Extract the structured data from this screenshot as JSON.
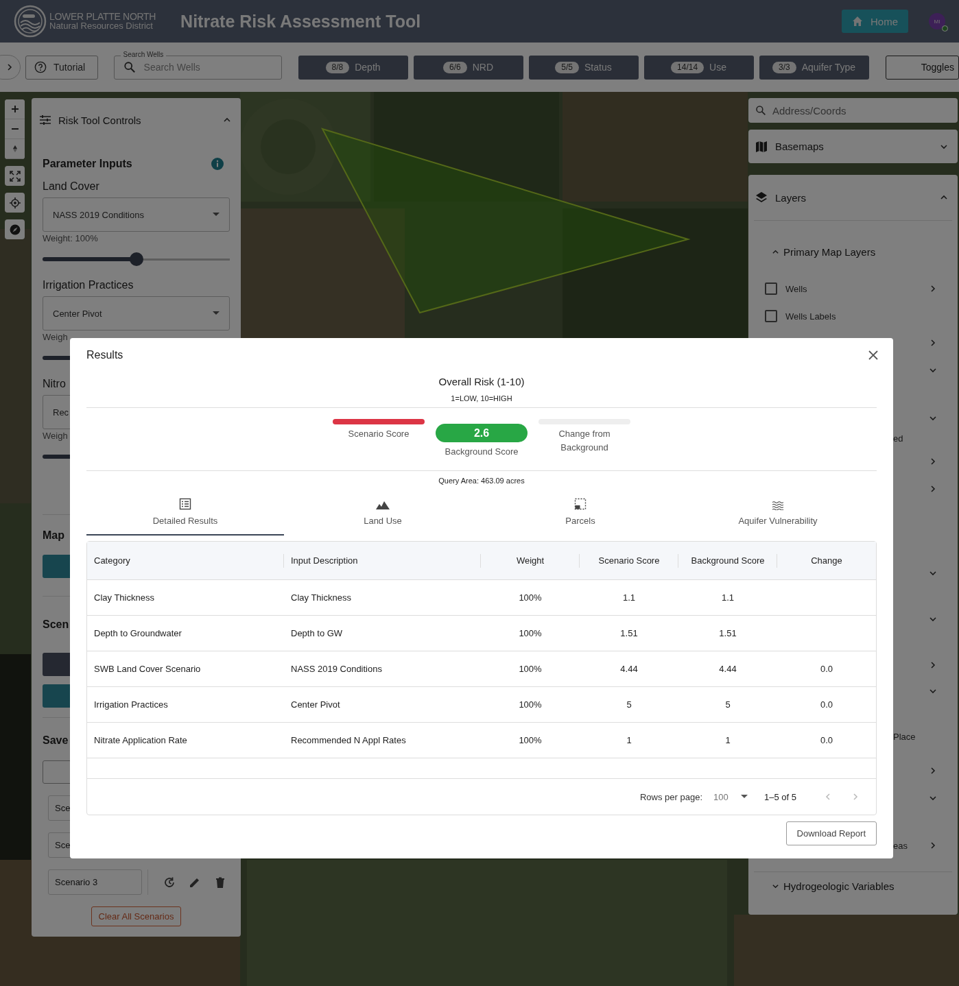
{
  "header": {
    "district_name": "LOWER PLATTE NORTH",
    "district_subtitle": "Natural Resources District",
    "title": "Nitrate Risk Assessment Tool",
    "home_button": "Home",
    "avatar_initials": "MI",
    "avatar_online": true
  },
  "toolbar": {
    "tutorial_button": "Tutorial",
    "well_search": {
      "label": "Search Wells",
      "placeholder": "Search Wells"
    },
    "filters": [
      {
        "count": "8/8",
        "label": "Depth"
      },
      {
        "count": "6/6",
        "label": "NRD"
      },
      {
        "count": "5/5",
        "label": "Status"
      },
      {
        "count": "14/14",
        "label": "Use"
      },
      {
        "count": "3/3",
        "label": "Aquifer Type"
      }
    ],
    "toggles_button": "Toggles"
  },
  "controls_panel": {
    "title": "Risk Tool Controls",
    "expanded": true,
    "section_title": "Parameter Inputs",
    "parameters": [
      {
        "label": "Land Cover",
        "value": "NASS 2019 Conditions",
        "weight": "Weight: 100%",
        "level": 0.5
      },
      {
        "label": "Irrigation Practices",
        "value": "Center Pivot",
        "weight": "Weigh"
      },
      {
        "label": "Nitro",
        "value": "Rec",
        "weight": "Weigh"
      }
    ],
    "map_section_title": "Map",
    "scenario_section_title": "Scen",
    "saved_section_title": "Save",
    "scenarios": [
      {
        "name": "Sce"
      },
      {
        "name": "Sce"
      },
      {
        "name": "Scenario 3"
      }
    ],
    "clear_button": "Clear All Scenarios"
  },
  "layers_panel": {
    "search_placeholder": "Address/Coords",
    "basemaps": {
      "title": "Basemaps",
      "expanded": false
    },
    "layers": {
      "title": "Layers",
      "expanded": true
    },
    "group": {
      "title": "Primary Map Layers",
      "expanded": true
    },
    "items": [
      {
        "label": "Wells",
        "checked": false,
        "kind": "submenu"
      },
      {
        "label": "Wells Labels",
        "checked": false,
        "kind": "plain"
      }
    ],
    "covered_rows": [
      {
        "kind": "item",
        "expanded": false
      },
      {
        "kind": "item",
        "expanded": true
      },
      {
        "kind": "described",
        "expanded": true,
        "fragment": "ed"
      },
      {
        "kind": "item",
        "expanded": false
      },
      {
        "kind": "item",
        "expanded": false
      },
      {
        "kind": "group",
        "expanded": true
      },
      {
        "kind": "sub",
        "expanded": true
      },
      {
        "kind": "sub",
        "expanded": false
      },
      {
        "kind": "item",
        "expanded": true
      },
      {
        "kind": "note",
        "fragment": "Place"
      },
      {
        "kind": "item",
        "expanded": false
      },
      {
        "kind": "item",
        "expanded": true
      },
      {
        "kind": "sub",
        "expanded": false,
        "fragment": "eas"
      }
    ],
    "footer_group": {
      "title": "Hydrogeologic Variables",
      "expanded": false
    }
  },
  "results_dialog": {
    "title": "Results",
    "risk_title": "Overall Risk (1-10)",
    "risk_scale": "1=LOW, 10=HIGH",
    "scores": [
      {
        "label": "Scenario Score",
        "color": "#dc3545"
      },
      {
        "label": "Background Score",
        "value": "2.6",
        "color": "#28a745"
      },
      {
        "label": "Change from Background",
        "color": "#eeeeee"
      }
    ],
    "query_area": "Query Area: 463.09 acres",
    "tabs": [
      {
        "label": "Detailed Results",
        "kind": "list",
        "selected": true
      },
      {
        "label": "Land Use",
        "kind": "terrain",
        "selected": false
      },
      {
        "label": "Parcels",
        "kind": "parcels",
        "selected": false
      },
      {
        "label": "Aquifer Vulnerability",
        "kind": "waves",
        "selected": false
      }
    ],
    "table": {
      "columns": [
        "Category",
        "Input Description",
        "Weight",
        "Scenario Score",
        "Background Score",
        "Change"
      ],
      "rows": [
        {
          "cells": [
            "Clay Thickness",
            "Clay Thickness",
            "100%",
            "1.1",
            "1.1"
          ]
        },
        {
          "cells": [
            "Depth to Groundwater",
            "Depth to GW",
            "100%",
            "1.51",
            "1.51"
          ]
        },
        {
          "cells": [
            "SWB Land Cover Scenario",
            "NASS 2019 Conditions",
            "100%",
            "4.44",
            "4.44",
            "0.0"
          ]
        },
        {
          "cells": [
            "Irrigation Practices",
            "Center Pivot",
            "100%",
            "5",
            "5",
            "0.0"
          ]
        },
        {
          "cells": [
            "Nitrate Application Rate",
            "Recommended N Appl Rates",
            "100%",
            "1",
            "1",
            "0.0"
          ]
        }
      ]
    },
    "pagination": {
      "rows_per_page_label": "Rows per page:",
      "rows_per_page": "100",
      "range": "1–5 of 5"
    },
    "download_button": "Download Report"
  }
}
